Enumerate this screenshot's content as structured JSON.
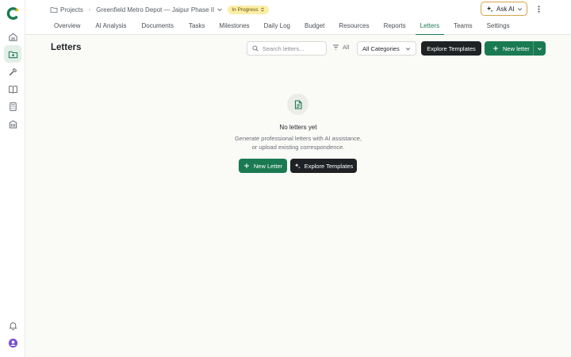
{
  "breadcrumb": {
    "projects": "Projects",
    "project_name": "Greenfield Metro Depot — Jaipur Phase II",
    "status": "In Progress"
  },
  "tabs": [
    {
      "label": "Overview"
    },
    {
      "label": "AI Analysis"
    },
    {
      "label": "Documents"
    },
    {
      "label": "Tasks"
    },
    {
      "label": "Milestones"
    },
    {
      "label": "Daily Log"
    },
    {
      "label": "Budget"
    },
    {
      "label": "Resources"
    },
    {
      "label": "Reports"
    },
    {
      "label": "Letters",
      "active": true
    },
    {
      "label": "Teams"
    },
    {
      "label": "Settings"
    }
  ],
  "ask_ai": {
    "label": "Ask AI"
  },
  "page": {
    "title": "Letters",
    "search_placeholder": "Search letters...",
    "filter_label": "All",
    "category_selected": "All Categories",
    "explore_label": "Explore Templates",
    "new_letter_label": "New letter"
  },
  "empty_state": {
    "title": "No letters yet",
    "desc_line1": "Generate professional letters with AI assistance,",
    "desc_line2": "or upload existing correspondence.",
    "new_letter_label": "New Letter",
    "explore_label": "Explore Templates"
  },
  "colors": {
    "brand_green": "#1a7a52",
    "dark_button": "#1f2224",
    "status_badge": "#fbeea8",
    "ask_ai_border": "#d7a24a"
  },
  "icons": {
    "sidebar": [
      "logo-icon",
      "home-icon",
      "projects-icon",
      "tools-icon",
      "book-icon",
      "calculator-icon",
      "building-icon",
      "bell-icon",
      "user-avatar-icon"
    ]
  }
}
